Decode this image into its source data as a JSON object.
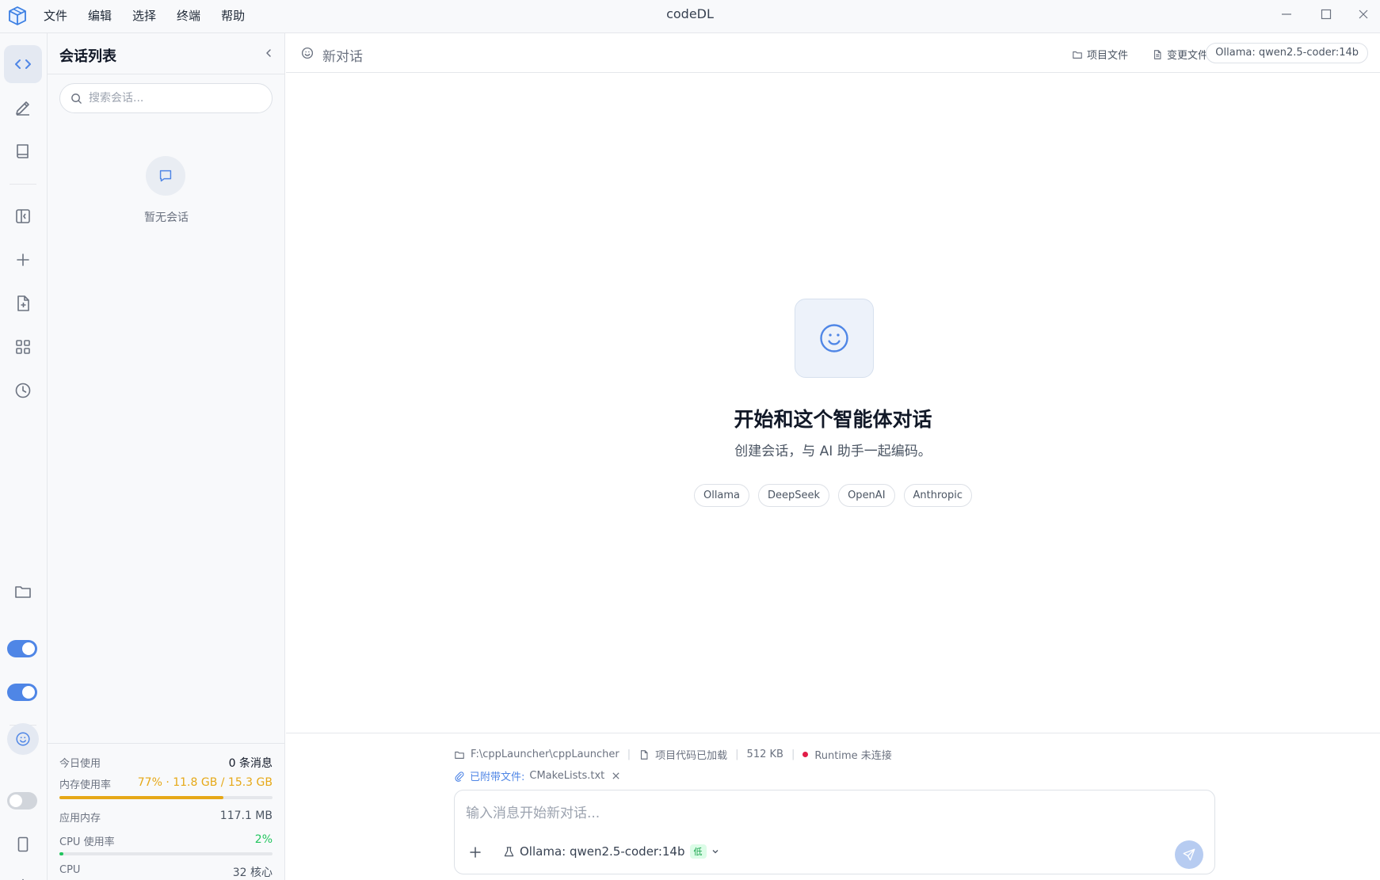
{
  "app": {
    "title": "codeDL"
  },
  "menu": [
    "文件",
    "编辑",
    "选择",
    "终端",
    "帮助"
  ],
  "sidebar": {
    "title": "会话列表",
    "search_placeholder": "搜索会话...",
    "empty_text": "暂无会话",
    "stats": {
      "today_label": "今日使用",
      "today_value": "0 条消息",
      "mem_label": "内存使用率",
      "mem_value": "77% · 11.8 GB / 15.3 GB",
      "mem_fraction": 0.77,
      "app_mem_label": "应用内存",
      "app_mem_value": "117.1 MB",
      "cpu_usage_label": "CPU 使用率",
      "cpu_usage_value": "2%",
      "cpu_fraction": 0.02,
      "cpu_label": "CPU",
      "cpu_value": "32 核心"
    }
  },
  "topbar": {
    "conversation_title": "新对话",
    "project_files": "项目文件",
    "changed_files": "变更文件",
    "model_pill": "Ollama: qwen2.5-coder:14b"
  },
  "center": {
    "title": "开始和这个智能体对话",
    "subtitle": "创建会话，与 AI 助手一起编码。",
    "providers": [
      "Ollama",
      "DeepSeek",
      "OpenAI",
      "Anthropic"
    ]
  },
  "composer": {
    "path": "F:\\cppLauncher\\cppLauncher",
    "code_status": "项目代码已加载",
    "size": "512 KB",
    "runtime": "Runtime 未连接",
    "attached_label": "已附带文件:",
    "attached_file": "CMakeLists.txt",
    "placeholder": "输入消息开始新对话...",
    "model": "Ollama: qwen2.5-coder:14b",
    "model_badge": "低"
  },
  "colors": {
    "accent": "#4f86e6",
    "warning": "#e6a817",
    "success": "#22c55e",
    "danger": "#e11d48"
  }
}
